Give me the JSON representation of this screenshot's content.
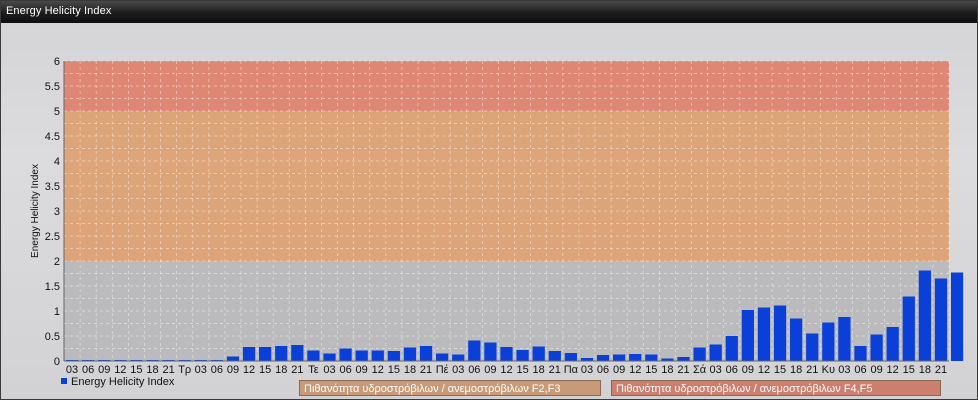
{
  "window": {
    "title": "Energy Helicity Index"
  },
  "chart_data": {
    "type": "bar",
    "title": "",
    "ylabel": "Energy Helicity Index",
    "xlabel": "",
    "ylim": [
      0,
      6
    ],
    "yticks": [
      "0",
      "0.5",
      "1",
      "1.5",
      "2",
      "2.5",
      "3",
      "3.5",
      "4",
      "4.5",
      "5",
      "5.5",
      "6"
    ],
    "categories": [
      "03",
      "06",
      "09",
      "12",
      "15",
      "18",
      "21",
      "Τρ",
      "03",
      "06",
      "09",
      "12",
      "15",
      "18",
      "21",
      "Τε",
      "03",
      "06",
      "09",
      "12",
      "15",
      "18",
      "21",
      "Πέ",
      "03",
      "06",
      "09",
      "12",
      "15",
      "18",
      "21",
      "Πα",
      "03",
      "06",
      "09",
      "12",
      "15",
      "18",
      "21",
      "Σά",
      "03",
      "06",
      "09",
      "12",
      "15",
      "18",
      "21",
      "Κυ",
      "03",
      "06",
      "09",
      "12",
      "15",
      "18",
      "21"
    ],
    "series": [
      {
        "name": "Energy Helicity Index",
        "color": "#0a3fd8",
        "values": [
          0.02,
          0.02,
          0.02,
          0.02,
          0.02,
          0.02,
          0.02,
          0.02,
          0.02,
          0.02,
          0.09,
          0.28,
          0.28,
          0.3,
          0.32,
          0.21,
          0.15,
          0.25,
          0.21,
          0.21,
          0.2,
          0.27,
          0.3,
          0.15,
          0.13,
          0.41,
          0.37,
          0.28,
          0.22,
          0.29,
          0.2,
          0.16,
          0.06,
          0.12,
          0.13,
          0.14,
          0.13,
          0.05,
          0.08,
          0.27,
          0.33,
          0.5,
          1.02,
          1.07,
          1.11,
          0.85,
          0.55,
          0.77,
          0.88,
          0.3,
          0.53,
          0.68,
          1.29,
          1.81,
          1.65,
          1.77
        ]
      }
    ],
    "bands": [
      {
        "from": 0,
        "to": 2,
        "color": "#b8b8bc"
      },
      {
        "from": 2,
        "to": 5,
        "color": "#dca070",
        "label": "Πιθανότητα υδροστρόβιλων / ανεμοστρόβιλων F2,F3"
      },
      {
        "from": 5,
        "to": 6,
        "color": "#e0806c",
        "label": "Πιθανότητα υδροστρόβιλων / ανεμοστρόβιλων F4,F5"
      }
    ],
    "grid": true,
    "legend_position": "bottom-left"
  }
}
